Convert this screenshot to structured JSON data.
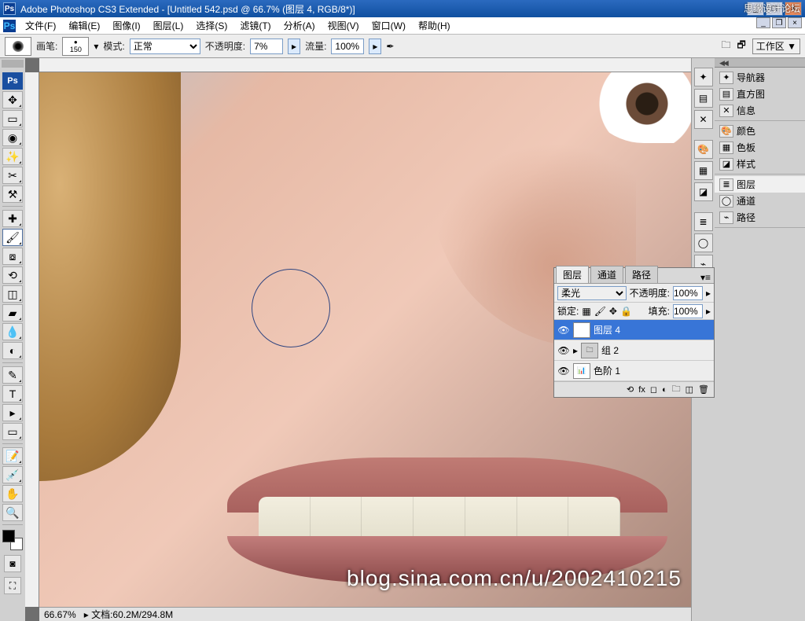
{
  "title": "Adobe Photoshop CS3 Extended - [Untitled 542.psd @ 66.7% (图层 4, RGB/8*)]",
  "brand": "思缘设计论坛",
  "window_controls": {
    "min": "_",
    "max": "□",
    "close": "×"
  },
  "subwin_controls": {
    "min": "_",
    "restore": "❐",
    "close": "×"
  },
  "menu": [
    "文件(F)",
    "编辑(E)",
    "图像(I)",
    "图层(L)",
    "选择(S)",
    "滤镜(T)",
    "分析(A)",
    "视图(V)",
    "窗口(W)",
    "帮助(H)"
  ],
  "options": {
    "brush_label": "画笔:",
    "brush_size": "150",
    "mode_label": "模式:",
    "mode_value": "正常",
    "opacity_label": "不透明度:",
    "opacity_value": "7%",
    "flow_label": "流量:",
    "flow_value": "100%",
    "workspace_label": "工作区 ▼"
  },
  "status": {
    "zoom": "66.67%",
    "doc_label": "文档:",
    "doc_value": "60.2M/294.8M"
  },
  "watermark": "blog.sina.com.cn/u/2002410215",
  "dock": {
    "g1": [
      "导航器",
      "直方图",
      "信息"
    ],
    "g2": [
      "颜色",
      "色板",
      "样式"
    ],
    "g3": [
      "图层",
      "通道",
      "路径"
    ]
  },
  "layers_panel": {
    "tabs": [
      "图层",
      "通道",
      "路径"
    ],
    "blend": "柔光",
    "opacity_label": "不透明度:",
    "opacity": "100%",
    "lock_label": "锁定:",
    "fill_label": "填充:",
    "fill": "100%",
    "layers": [
      {
        "name": "图层 4",
        "sel": true,
        "vis": "👁"
      },
      {
        "name": "组 2",
        "sel": false,
        "vis": "👁",
        "group": true
      },
      {
        "name": "色阶 1",
        "sel": false,
        "vis": "👁"
      }
    ]
  }
}
